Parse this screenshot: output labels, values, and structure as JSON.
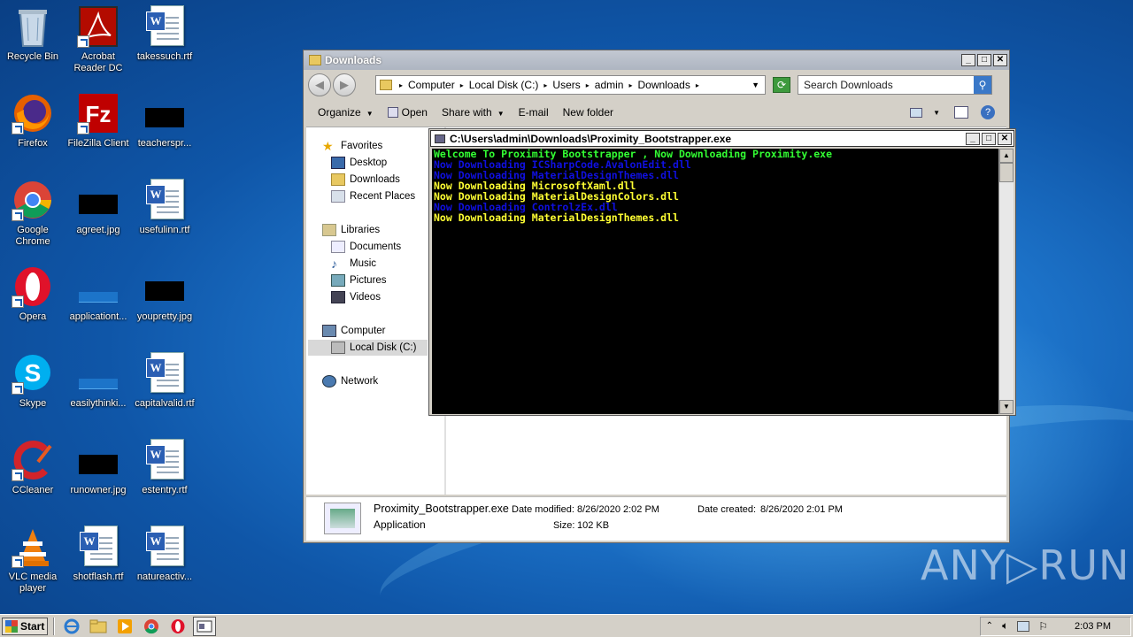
{
  "desktop": {
    "icons": [
      {
        "label": "Recycle Bin"
      },
      {
        "label": "Acrobat Reader DC"
      },
      {
        "label": "takessuch.rtf"
      },
      {
        "label": "Firefox"
      },
      {
        "label": "FileZilla Client"
      },
      {
        "label": "teacherspr..."
      },
      {
        "label": "Google Chrome"
      },
      {
        "label": "agreet.jpg"
      },
      {
        "label": "usefulinn.rtf"
      },
      {
        "label": "Opera"
      },
      {
        "label": "applicationt..."
      },
      {
        "label": "youpretty.jpg"
      },
      {
        "label": "Skype"
      },
      {
        "label": "easilythinki..."
      },
      {
        "label": "capitalvalid.rtf"
      },
      {
        "label": "CCleaner"
      },
      {
        "label": "runowner.jpg"
      },
      {
        "label": "estentry.rtf"
      },
      {
        "label": "VLC media player"
      },
      {
        "label": "shotflash.rtf"
      },
      {
        "label": "natureactiv..."
      }
    ]
  },
  "explorer": {
    "title": "Downloads",
    "breadcrumb": [
      "Computer",
      "Local Disk (C:)",
      "Users",
      "admin",
      "Downloads"
    ],
    "search_placeholder": "Search Downloads",
    "toolbar": {
      "organize": "Organize",
      "open": "Open",
      "share_with": "Share with",
      "email": "E-mail",
      "new_folder": "New folder"
    },
    "nav": {
      "favorites": "Favorites",
      "desktop": "Desktop",
      "downloads": "Downloads",
      "recent_places": "Recent Places",
      "libraries": "Libraries",
      "documents": "Documents",
      "music": "Music",
      "pictures": "Pictures",
      "videos": "Videos",
      "computer": "Computer",
      "local_disk": "Local Disk (C:)",
      "network": "Network"
    },
    "details": {
      "filename": "Proximity_Bootstrapper.exe",
      "type": "Application",
      "date_modified_label": "Date modified:",
      "date_modified": "8/26/2020 2:02 PM",
      "date_created_label": "Date created:",
      "date_created": "8/26/2020 2:01 PM",
      "size_label": "Size:",
      "size": "102 KB"
    }
  },
  "console": {
    "title": "C:\\Users\\admin\\Downloads\\Proximity_Bootstrapper.exe",
    "lines": [
      {
        "text": "Welcome To Proximity Bootstrapper , Now Downloading Proximity.exe",
        "color": "#33ff33"
      },
      {
        "text": "Now Downloading ICSharpCode.AvalonEdit.dll",
        "color": "#1010e0"
      },
      {
        "text": "Now Downloading MaterialDesignThemes.dll",
        "color": "#1010e0"
      },
      {
        "text": "Now Downloading MicrosoftXaml.dll",
        "color": "#ffff33"
      },
      {
        "text": "Now Downloading MaterialDesignColors.dll",
        "color": "#ffff33"
      },
      {
        "text": "Now Downloading ControlzEx.dll",
        "color": "#1010e0"
      },
      {
        "text": "Now Downloading MaterialDesignThemes.dll",
        "color": "#ffff33"
      }
    ]
  },
  "watermark": "ANY▷RUN",
  "taskbar": {
    "start": "Start",
    "clock": "2:03 PM"
  }
}
